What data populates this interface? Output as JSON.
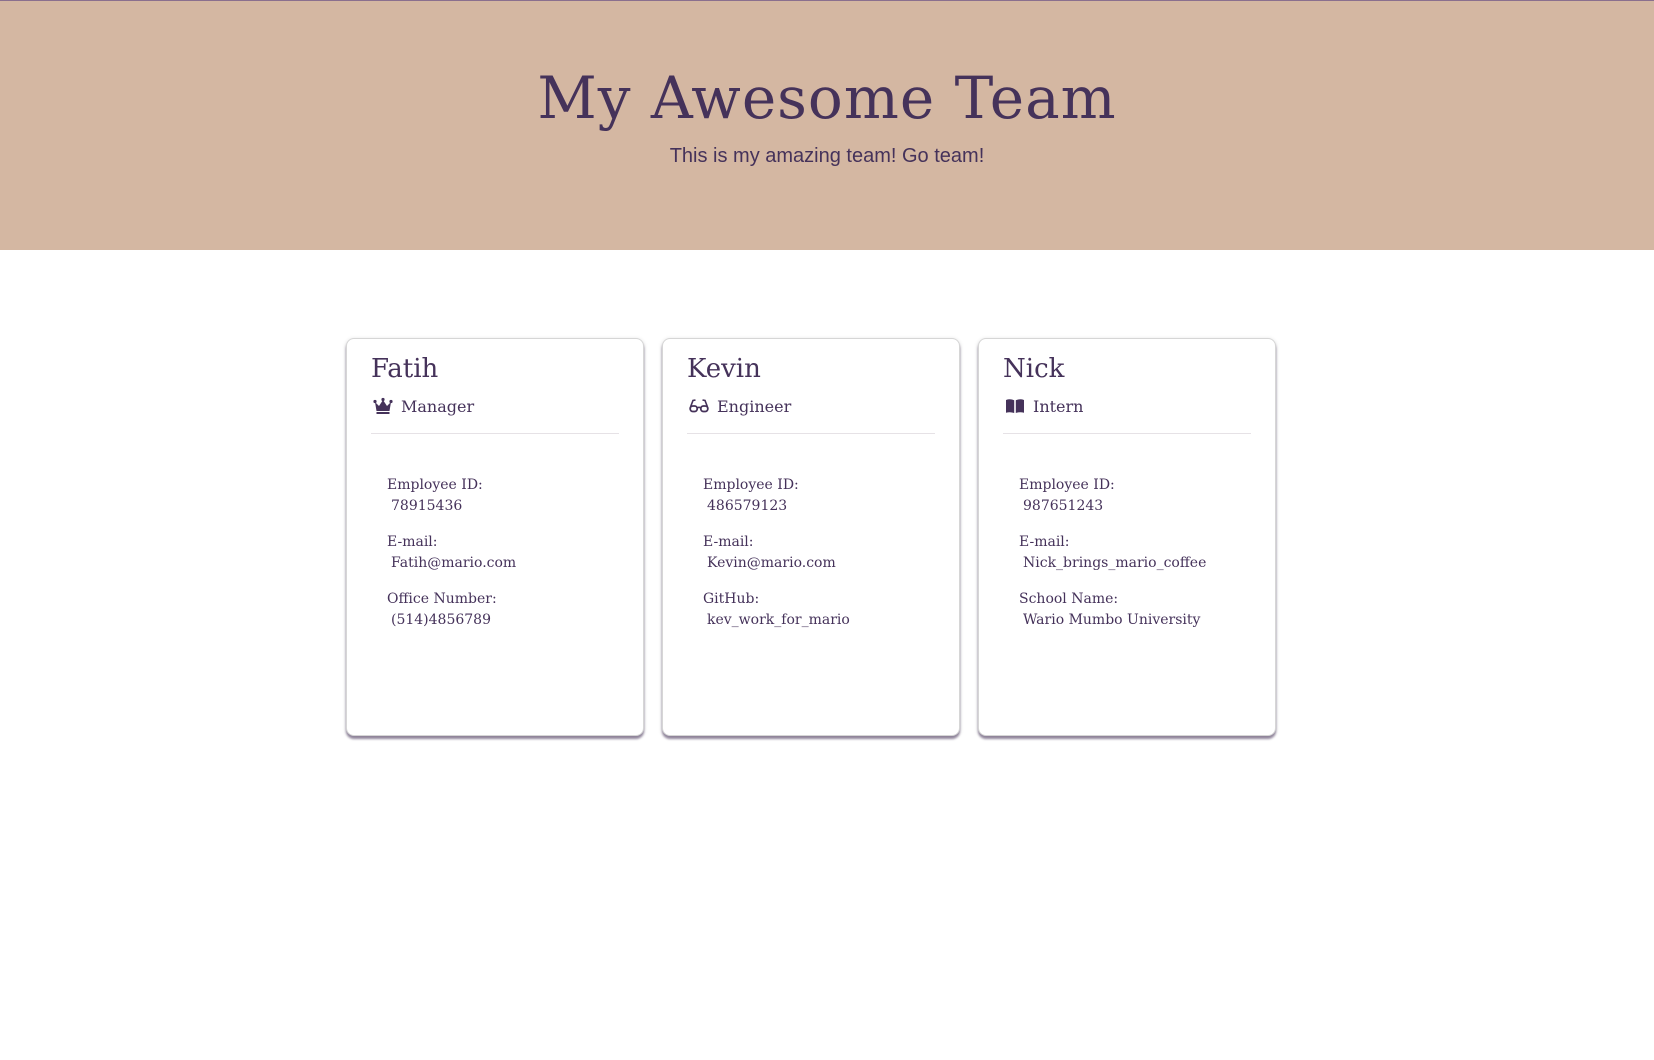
{
  "header": {
    "title": "My Awesome Team",
    "subtitle": "This is my amazing team! Go team!"
  },
  "colors": {
    "header_bg": "#d4b7a2",
    "text": "#45325a",
    "card_bg": "#ffffff"
  },
  "team": [
    {
      "name": "Fatih",
      "role": "Manager",
      "icon": "crown-icon",
      "details": [
        {
          "label": "Employee ID:",
          "value": "78915436"
        },
        {
          "label": "E-mail:",
          "value": "Fatih@mario.com"
        },
        {
          "label": "Office Number:",
          "value": "(514)4856789"
        }
      ]
    },
    {
      "name": "Kevin",
      "role": "Engineer",
      "icon": "glasses-icon",
      "details": [
        {
          "label": "Employee ID:",
          "value": "486579123"
        },
        {
          "label": "E-mail:",
          "value": "Kevin@mario.com"
        },
        {
          "label": "GitHub:",
          "value": "kev_work_for_mario"
        }
      ]
    },
    {
      "name": "Nick",
      "role": "Intern",
      "icon": "book-icon",
      "details": [
        {
          "label": "Employee ID:",
          "value": "987651243"
        },
        {
          "label": "E-mail:",
          "value": "Nick_brings_mario_coffee"
        },
        {
          "label": "School Name:",
          "value": "Wario Mumbo University"
        }
      ]
    }
  ]
}
